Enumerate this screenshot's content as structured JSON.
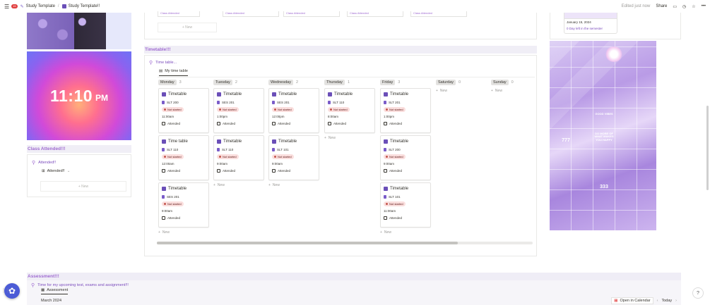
{
  "topbar": {
    "notif_count": "15",
    "crumb1": "Study Template",
    "crumb2": "Study Template!!",
    "edited": "Edited just now",
    "share": "Share"
  },
  "top_partial": {
    "card_texts": [
      "Class Attended",
      "Class Attended",
      "Class Attended",
      "Class Attended",
      "Class Attended"
    ],
    "new_label": "New"
  },
  "clock": {
    "time": "11:10",
    "ampm": "PM"
  },
  "class_attended": {
    "heading": "Class Attended!!!",
    "callout": "Attended!!",
    "view": "Attended!!",
    "new_label": "New"
  },
  "timetable": {
    "heading": "Timetable!!!",
    "callout": "Time table...",
    "view_tab": "My time table",
    "status_label": "Not started",
    "attended_label": "Attended",
    "new_label": "New",
    "columns": [
      {
        "day": "Monday",
        "count": "3",
        "cards": [
          {
            "title": "Timetable",
            "course": "SLT 200",
            "time": "11:00am"
          },
          {
            "title": "Time table",
            "course": "SLT 110",
            "time": "12:00am"
          },
          {
            "title": "Timetable",
            "course": "SES 201",
            "time": "9:00am"
          }
        ]
      },
      {
        "day": "Tuesday",
        "count": "2",
        "cards": [
          {
            "title": "Timetable",
            "course": "SES 201",
            "time": "1:00pm"
          },
          {
            "title": "Timetable",
            "course": "SLT 110",
            "time": "9:00am"
          }
        ]
      },
      {
        "day": "Wednesday",
        "count": "2",
        "cards": [
          {
            "title": "Timetable",
            "course": "SES 201",
            "time": "12:00pm"
          },
          {
            "title": "Timetable",
            "course": "SLT 101",
            "time": "9:00am"
          }
        ]
      },
      {
        "day": "Thursday",
        "count": "1",
        "cards": [
          {
            "title": "Timetable",
            "course": "SLT 110",
            "time": "8:00am"
          }
        ]
      },
      {
        "day": "Friday",
        "count": "3",
        "cards": [
          {
            "title": "Timetable",
            "course": "SLT 201",
            "time": "1:00pm"
          },
          {
            "title": "Timetable",
            "course": "SLT 200",
            "time": "9:00am"
          },
          {
            "title": "Timetable",
            "course": "SLT 101",
            "time": "11:00am"
          }
        ]
      },
      {
        "day": "Saturday",
        "count": "0",
        "cards": []
      },
      {
        "day": "Sunday",
        "count": "0",
        "cards": []
      }
    ]
  },
  "semester_card": {
    "date": "January 15, 2024",
    "days_left": "0 Day left in the semester"
  },
  "collage_texts": [
    "DO MORE OF WHAT MAKES YOU HAPPY",
    "GOOD VIBES",
    "333",
    "777"
  ],
  "assessment": {
    "heading": "Assessment!!!",
    "callout": "Time for my upcoming test, exams and assignment!!!",
    "view_tab": "Assessment",
    "month": "March 2024",
    "open_calendar": "Open in Calendar",
    "today": "Today"
  },
  "help": "?"
}
